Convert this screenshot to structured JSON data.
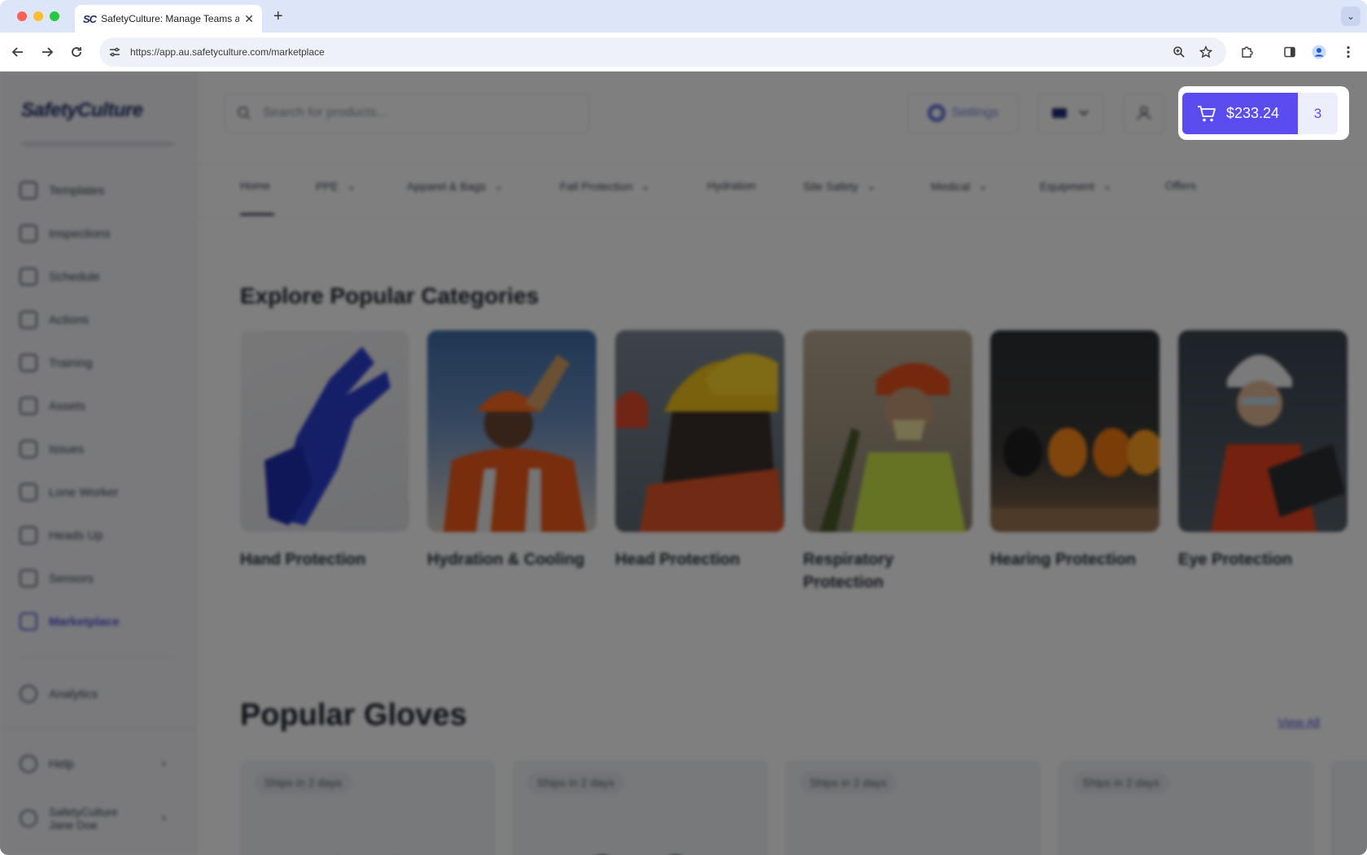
{
  "browser": {
    "tab_title": "SafetyCulture: Manage Teams and...",
    "tab_favicon": "SC",
    "url": "https://app.au.safetyculture.com/marketplace"
  },
  "sidebar": {
    "logo": "SafetyCulture",
    "items": [
      {
        "label": "Templates",
        "icon": "templates-icon"
      },
      {
        "label": "Inspections",
        "icon": "inspections-icon"
      },
      {
        "label": "Schedule",
        "icon": "schedule-icon"
      },
      {
        "label": "Actions",
        "icon": "actions-icon"
      },
      {
        "label": "Training",
        "icon": "training-icon"
      },
      {
        "label": "Assets",
        "icon": "assets-icon"
      },
      {
        "label": "Issues",
        "icon": "issues-icon"
      },
      {
        "label": "Lone Worker",
        "icon": "lone-worker-icon"
      },
      {
        "label": "Heads Up",
        "icon": "heads-up-icon"
      },
      {
        "label": "Sensors",
        "icon": "sensors-icon"
      },
      {
        "label": "Marketplace",
        "icon": "cart-icon",
        "active": true
      }
    ],
    "analytics": "Analytics",
    "help": "Help",
    "org": "SafetyCulture",
    "user": "Jane Doe"
  },
  "header": {
    "search_placeholder": "Search for products...",
    "settings_label": "Settings",
    "cart_total": "$233.24",
    "cart_count": "3"
  },
  "categories_nav": [
    "Home",
    "PPE",
    "Apparel & Bags",
    "Fall Protection",
    "Hydration",
    "Site Safety",
    "Medical",
    "Equipment",
    "Offers"
  ],
  "explore": {
    "title": "Explore Popular Categories",
    "cards": [
      "Hand Protection",
      "Hydration & Cooling",
      "Head Protection",
      "Respiratory Protection",
      "Hearing Protection",
      "Eye Protection"
    ]
  },
  "popular_gloves": {
    "title": "Popular Gloves",
    "view_all": "View All",
    "products": [
      {
        "badge": "Ships in 2 days"
      },
      {
        "badge": "Ships in 2 days"
      },
      {
        "badge": "Ships in 2 days"
      },
      {
        "badge": "Ships in 2 days"
      }
    ]
  },
  "colors": {
    "accent": "#5b4cf0",
    "brand_navy": "#1b2a64"
  }
}
